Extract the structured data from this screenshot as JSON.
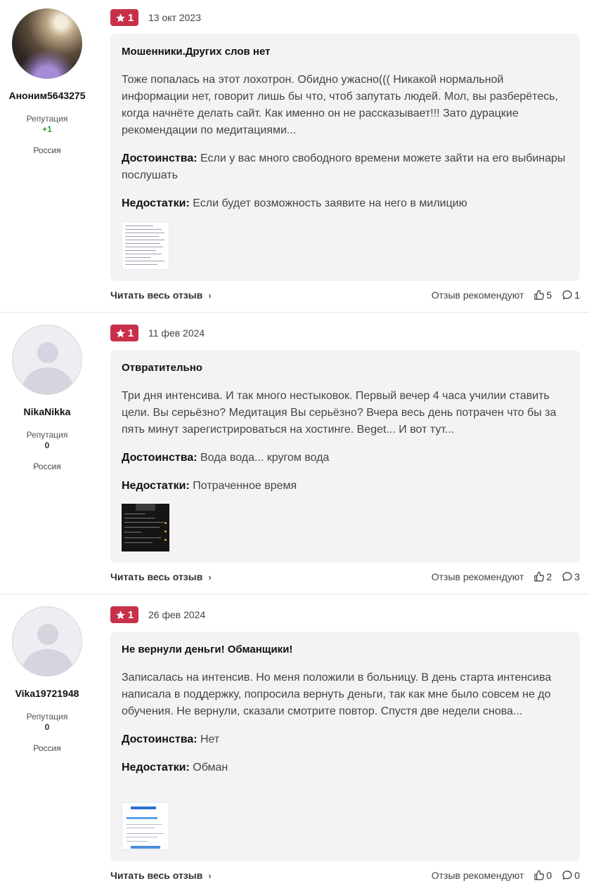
{
  "labels": {
    "reputation": "Репутация",
    "pros": "Достоинства:",
    "cons": "Недостатки:",
    "read_more": "Читать весь отзыв",
    "recommend": "Отзыв рекомендуют"
  },
  "reviews": [
    {
      "author": "Аноним5643275",
      "reputation": "+1",
      "country": "Россия",
      "rating": "1",
      "date": "13 окт 2023",
      "title": "Мошенники.Других слов нет",
      "text": "Тоже попалась на этот лохотрон. Обидно ужасно((( Никакой нормальной информации нет, говорит лишь бы что, чтоб запутать людей. Мол, вы разберётесь, когда начнёте делать сайт. Как именно он не рассказывает!!! Зато дурацкие рекомендации по медитациями...",
      "pros": "Если у вас много свободного времени можете зайти на его выбинары послушать",
      "cons": "Если будет возможность заявите на него в милицию",
      "likes": "5",
      "comments": "1"
    },
    {
      "author": "NikaNikka",
      "reputation": "0",
      "country": "Россия",
      "rating": "1",
      "date": "11 фев 2024",
      "title": "Отвратительно",
      "text": "Три дня интенсива. И так много нестыковок. Первый вечер 4 часа училии ставить цели. Вы серьёзно? Медитация Вы серьёзно? Вчера весь день потрачен что бы за пять минут зарегистрироваться на хостинге. Beget... И вот тут...",
      "pros": "Вода вода... кругом вода",
      "cons": "Потраченное время",
      "likes": "2",
      "comments": "3"
    },
    {
      "author": "Vika19721948",
      "reputation": "0",
      "country": "Россия",
      "rating": "1",
      "date": "26 фев 2024",
      "title": "Не вернули деньги! Обманщики!",
      "text": "Записалась на интенсив. Но меня положили в больницу. В день старта интенсива написала в поддержку, попросила вернуть деньги, так как мне было совсем не до обучения. Не вернули, сказали смотрите повтор. Спустя две недели снова...",
      "pros": "Нет",
      "cons": "Обман",
      "likes": "0",
      "comments": "0"
    }
  ],
  "icons": {
    "star": "star-icon",
    "like": "thumbs-up-icon",
    "comment": "comment-icon",
    "chevron": "chevron-right-icon"
  },
  "colors": {
    "rating_badge": "#c8304a",
    "positive_reputation": "#2e9e3a",
    "card_background": "#f3f3f6"
  }
}
